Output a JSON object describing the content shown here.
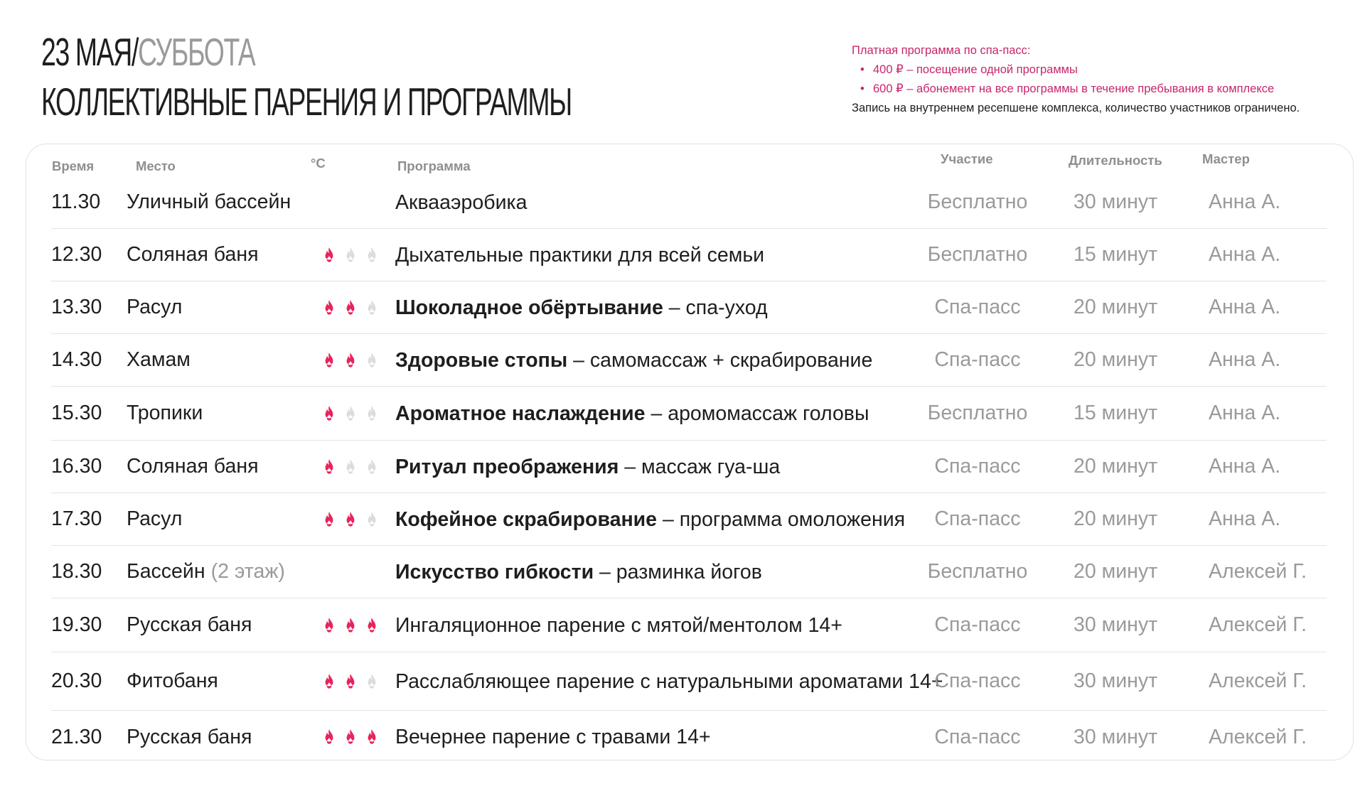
{
  "header": {
    "date": "23 МАЯ",
    "separator": "/",
    "weekday": "СУББОТА",
    "title": "КОЛЛЕКТИВНЫЕ ПАРЕНИЯ И ПРОГРАММЫ"
  },
  "note": {
    "heading": "Платная программа по спа-пасс:",
    "items": [
      "400 ₽  – посещение одной программы",
      "600 ₽ – абонемент на все программы в течение пребывания в комплексе"
    ],
    "bullet": "•",
    "footer": "Запись на внутреннем ресепшене комплекса, количество участников ограничено."
  },
  "columns": {
    "time": "Время",
    "place": "Место",
    "temp": "°С",
    "program": "Программа",
    "participation": "Участие",
    "duration": "Длительность",
    "master": "Мастер"
  },
  "colors": {
    "accent": "#c6266c",
    "flame_on": "#e8245c",
    "flame_off": "#dcdcdc",
    "muted": "#9a9a9a"
  },
  "rows": [
    {
      "time": "11.30",
      "place": "Уличный бассейн",
      "place_note": "",
      "heat": 0,
      "program_bold": "",
      "program_rest": "Аквааэробика",
      "participation": "Бесплатно",
      "duration": "30 минут",
      "master": "Анна А."
    },
    {
      "time": "12.30",
      "place": "Соляная баня",
      "place_note": "",
      "heat": 1,
      "program_bold": "",
      "program_rest": "Дыхательные практики для всей семьи",
      "participation": "Бесплатно",
      "duration": "15 минут",
      "master": "Анна А."
    },
    {
      "time": "13.30",
      "place": "Расул",
      "place_note": "",
      "heat": 2,
      "program_bold": "Шоколадное обёртывание",
      "program_rest": " – спа-уход",
      "participation": "Спа-пасс",
      "duration": "20 минут",
      "master": "Анна А."
    },
    {
      "time": "14.30",
      "place": "Хамам",
      "place_note": "",
      "heat": 2,
      "program_bold": "Здоровые стопы",
      "program_rest": " – самомассаж + скрабирование",
      "participation": "Спа-пасс",
      "duration": "20 минут",
      "master": "Анна А."
    },
    {
      "time": "15.30",
      "place": "Тропики",
      "place_note": "",
      "heat": 1,
      "program_bold": "Ароматное наслаждение",
      "program_rest": " – аромомассаж головы",
      "participation": "Бесплатно",
      "duration": "15 минут",
      "master": "Анна А."
    },
    {
      "time": "16.30",
      "place": "Соляная баня",
      "place_note": "",
      "heat": 1,
      "program_bold": "Ритуал преображения",
      "program_rest": " – массаж гуа-ша",
      "participation": "Спа-пасс",
      "duration": "20 минут",
      "master": "Анна А."
    },
    {
      "time": "17.30",
      "place": "Расул",
      "place_note": "",
      "heat": 2,
      "program_bold": "Кофейное скрабирование",
      "program_rest": " – программа омоложения",
      "participation": "Спа-пасс",
      "duration": "20 минут",
      "master": "Анна А."
    },
    {
      "time": "18.30",
      "place": "Бассейн",
      "place_note": "(2 этаж)",
      "heat": 0,
      "program_bold": "Искусство гибкости",
      "program_rest": " – разминка йогов",
      "participation": "Бесплатно",
      "duration": "20 минут",
      "master": "Алексей Г."
    },
    {
      "time": "19.30",
      "place": "Русская баня",
      "place_note": "",
      "heat": 3,
      "program_bold": "",
      "program_rest": "Ингаляционное парение с мятой/ментолом 14+",
      "participation": "Спа-пасс",
      "duration": "30 минут",
      "master": "Алексей Г."
    },
    {
      "time": "20.30",
      "place": "Фитобаня",
      "place_note": "",
      "heat": 2,
      "program_bold": "",
      "program_rest": "Расслабляющее парение с натуральными ароматами 14+",
      "participation": "Спа-пасс",
      "duration": "30 минут",
      "master": "Алексей Г."
    },
    {
      "time": "21.30",
      "place": "Русская баня",
      "place_note": "",
      "heat": 3,
      "program_bold": "",
      "program_rest": "Вечернее парение с травами 14+",
      "participation": "Спа-пасс",
      "duration": "30 минут",
      "master": "Алексей Г."
    }
  ]
}
